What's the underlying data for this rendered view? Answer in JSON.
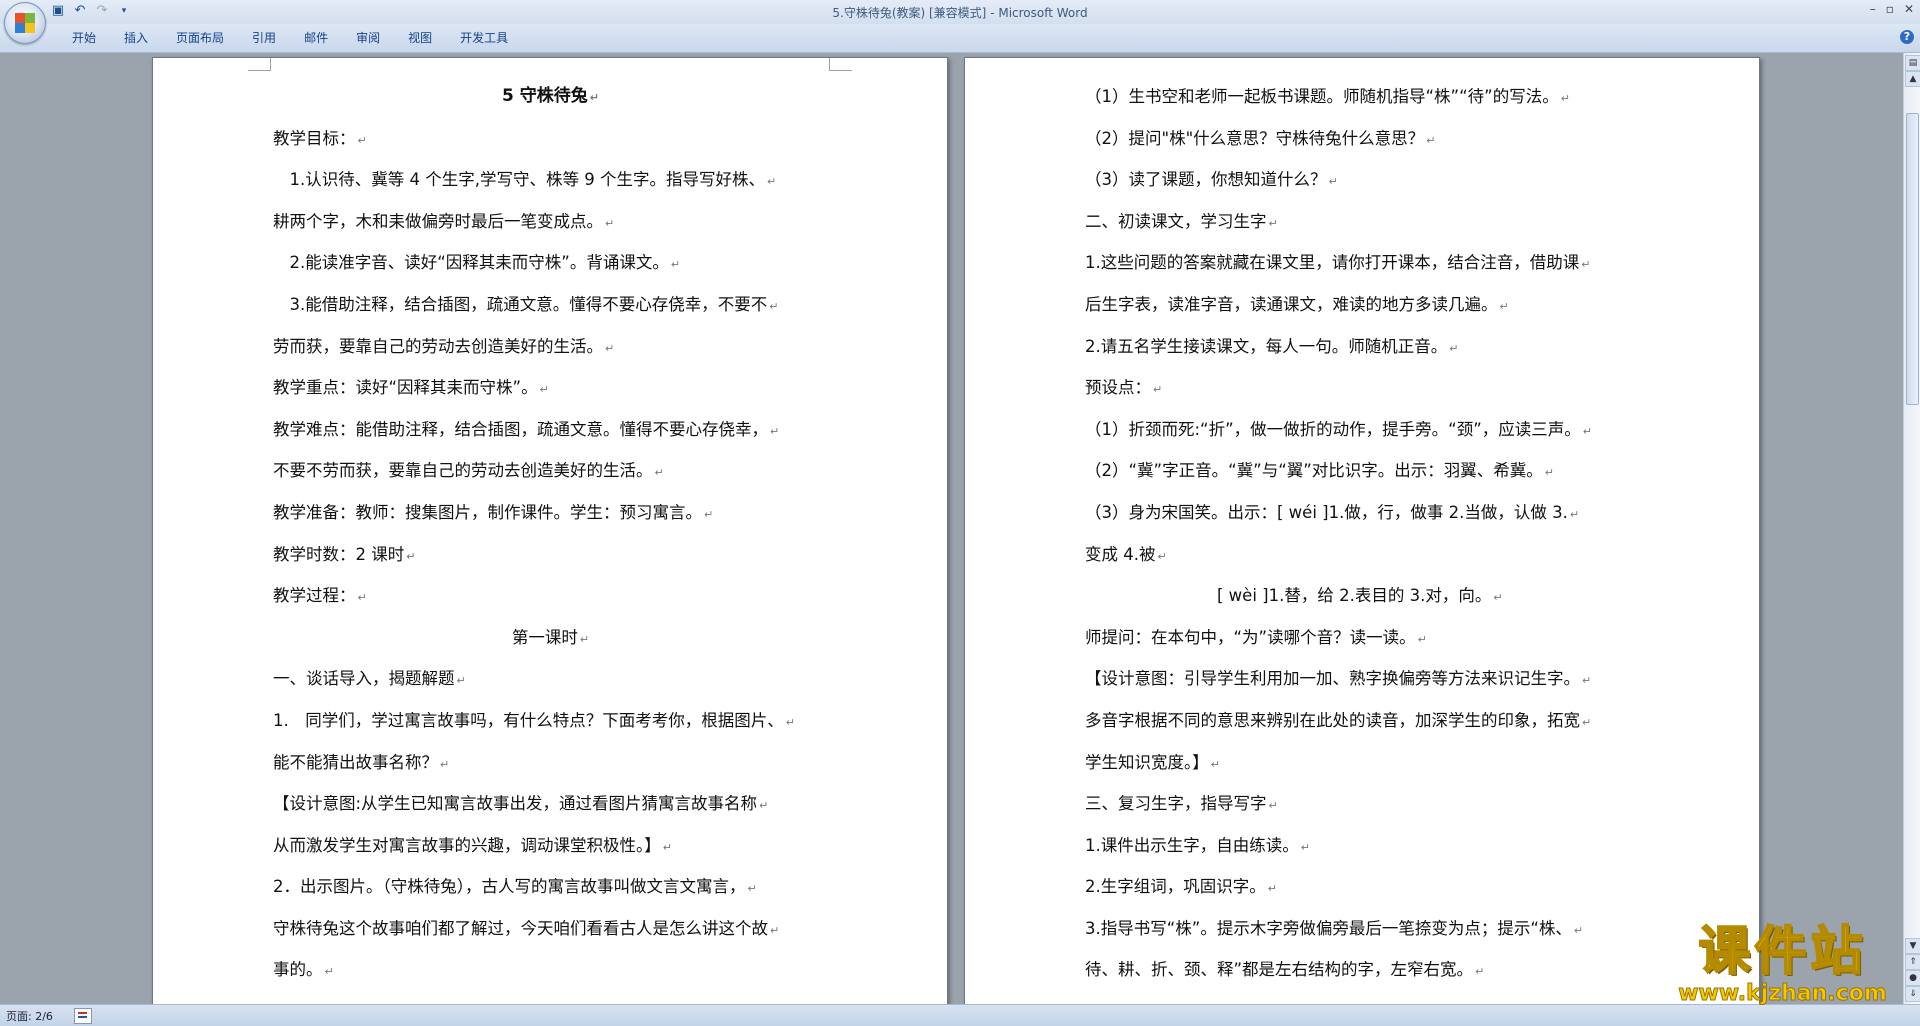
{
  "window": {
    "title": "5.守株待兔(教案) [兼容模式]",
    "separator": " - ",
    "app_name": "Microsoft Word"
  },
  "quick_access": {
    "icons": [
      "save-icon",
      "undo-icon",
      "redo-icon",
      "customize-icon"
    ]
  },
  "ribbon": {
    "tabs": [
      "开始",
      "插入",
      "页面布局",
      "引用",
      "邮件",
      "审阅",
      "视图",
      "开发工具"
    ]
  },
  "pages": {
    "left": [
      "5 守株待兔",
      "教学目标：",
      "　1.认识待、冀等 4 个生字,学写守、株等 9 个生字。指导写好株、",
      "耕两个字，木和耒做偏旁时最后一笔变成点。",
      "　2.能读准字音、读好“因释其耒而守株”。背诵课文。",
      "　3.能借助注释，结合插图，疏通文意。懂得不要心存侥幸，不要不",
      "劳而获，要靠自己的劳动去创造美好的生活。",
      "教学重点：读好“因释其耒而守株”。",
      "教学难点：能借助注释，结合插图，疏通文意。懂得不要心存侥幸，",
      "不要不劳而获，要靠自己的劳动去创造美好的生活。",
      "教学准备：教师：搜集图片，制作课件。学生：预习寓言。",
      "教学时数：2 课时",
      "教学过程：",
      "第一课时",
      "一、谈话导入，揭题解题",
      "1.　同学们，学过寓言故事吗，有什么特点？下面考考你，根据图片、",
      "能不能猜出故事名称？",
      "【设计意图:从学生已知寓言故事出发，通过看图片猜寓言故事名称",
      "从而激发学生对寓言故事的兴趣，调动课堂积极性。】",
      "2．出示图片。（守株待兔），古人写的寓言故事叫做文言文寓言，",
      "守株待兔这个故事咱们都了解过，今天咱们看看古人是怎么讲这个故",
      "事的。"
    ],
    "right": [
      "（1）生书空和老师一起板书课题。师随机指导“株”“待”的写法。",
      "（2）提问\"株\"什么意思？守株待兔什么意思？",
      "（3）读了课题，你想知道什么？",
      "二、初读课文，学习生字",
      "1.这些问题的答案就藏在课文里，请你打开课本，结合注音，借助课",
      "后生字表，读准字音，读通课文，难读的地方多读几遍。",
      "2.请五名学生接读课文，每人一句。师随机正音。",
      "预设点：",
      "（1）折颈而死:“折”，做一做折的动作，提手旁。“颈”，应读三声。",
      "（2）“冀”字正音。“冀”与“翼”对比识字。出示：羽翼、希冀。",
      "（3）身为宋国笑。出示：[ wéi ]1.做，行，做事 2.当做，认做 3.",
      "变成 4.被",
      "　　　　　　　　[ wèi ]1.替，给 2.表目的 3.对，向。",
      "师提问：在本句中，“为”读哪个音？读一读。",
      "【设计意图：引导学生利用加一加、熟字换偏旁等方法来识记生字。",
      "多音字根据不同的意思来辨别在此处的读音，加深学生的印象，拓宽",
      "学生知识宽度。】",
      "三、复习生字，指导写字",
      "1.课件出示生字，自由练读。",
      "2.生字组词，巩固识字。",
      "3.指导书写“株”。提示木字旁做偏旁最后一笔捺变为点；提示“株、",
      "待、耕、折、颈、释”都是左右结构的字，左窄右宽。"
    ],
    "paragraph_mark": "↵"
  },
  "status": {
    "page_count": "页面: 2/6"
  },
  "watermark": {
    "text": "课件站",
    "url": "www.kjzhan.com"
  }
}
